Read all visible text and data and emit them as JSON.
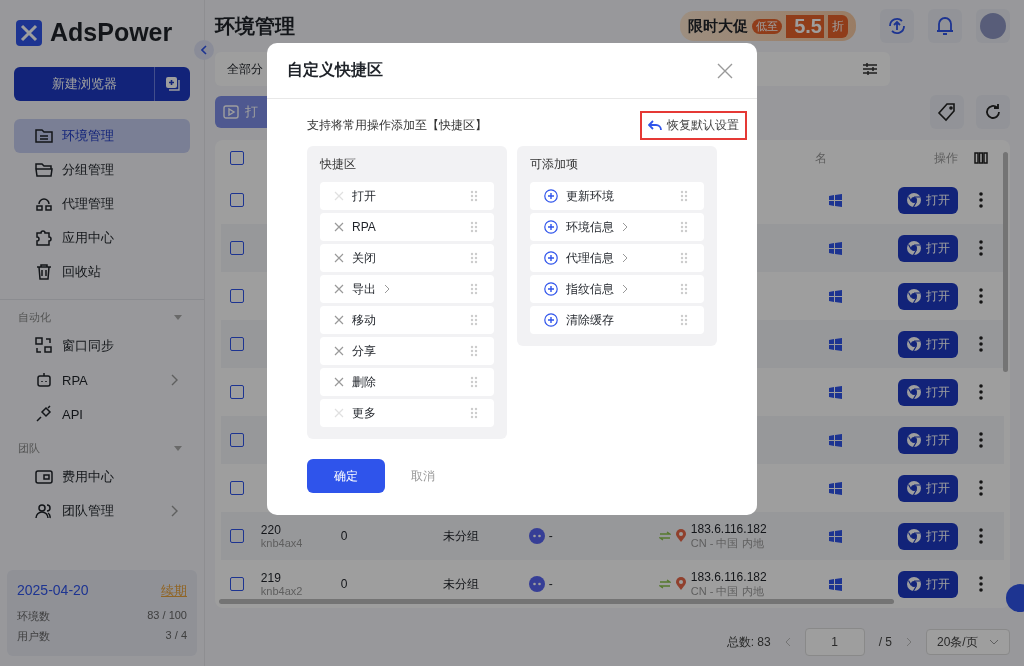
{
  "brand": {
    "name": "AdsPower"
  },
  "sidebar": {
    "new_button": "新建浏览器",
    "nav": [
      {
        "label": "环境管理",
        "kind": "folder-list",
        "selected": true
      },
      {
        "label": "分组管理",
        "kind": "folder",
        "selected": false
      },
      {
        "label": "代理管理",
        "kind": "network",
        "selected": false
      },
      {
        "label": "应用中心",
        "kind": "puzzle",
        "selected": false
      },
      {
        "label": "回收站",
        "kind": "trash",
        "selected": false
      }
    ],
    "sections": [
      {
        "title": "自动化",
        "items": [
          {
            "label": "窗口同步",
            "kind": "sync",
            "has_submenu": false
          },
          {
            "label": "RPA",
            "kind": "robot",
            "has_submenu": true
          },
          {
            "label": "API",
            "kind": "plug",
            "has_submenu": false
          }
        ]
      },
      {
        "title": "团队",
        "items": [
          {
            "label": "费用中心",
            "kind": "wallet",
            "has_submenu": false
          },
          {
            "label": "团队管理",
            "kind": "users",
            "has_submenu": true
          }
        ]
      }
    ],
    "plan": {
      "expiry": "2025-04-20",
      "renew": "续期",
      "stats": [
        {
          "label": "环境数",
          "value": "83 / 100"
        },
        {
          "label": "用户数",
          "value": "3 / 4"
        }
      ]
    }
  },
  "header": {
    "title": "环境管理",
    "promo": {
      "text": "限时大促",
      "tag": "低至",
      "discount": "5.5",
      "unit": "折"
    }
  },
  "toolbar": {
    "group_filter": "全部分",
    "open_button": "打"
  },
  "table": {
    "select_all_checked": false,
    "columns": [
      {
        "label": "名"
      },
      {
        "label": "操作"
      }
    ],
    "rows": [
      {
        "checked": false,
        "action": "打开"
      },
      {
        "checked": false,
        "action": "打开"
      },
      {
        "checked": false,
        "action": "打开"
      },
      {
        "checked": false,
        "action": "打开"
      },
      {
        "checked": false,
        "action": "打开"
      },
      {
        "checked": false,
        "action": "打开"
      },
      {
        "checked": false,
        "action": "打开"
      },
      {
        "checked": false,
        "id": "220",
        "code": "knb4ax4",
        "count": "0",
        "group": "未分组",
        "platform": "-",
        "ip": "183.6.116.182",
        "location": "CN - 中国 内地",
        "action": "打开"
      },
      {
        "checked": false,
        "id": "219",
        "code": "knb4ax2",
        "count": "0",
        "group": "未分组",
        "platform": "-",
        "ip": "183.6.116.182",
        "location": "CN - 中国 内地",
        "action": "打开"
      }
    ]
  },
  "pagination": {
    "total": "总数: 83",
    "page": "1",
    "pages": "/ 5",
    "page_size": "20条/页"
  },
  "dialog": {
    "title": "自定义快捷区",
    "hint": "支持将常用操作添加至【快捷区】",
    "restore": {
      "label": "恢复默认设置",
      "highlighted": true
    },
    "quick": {
      "title": "快捷区",
      "items": [
        {
          "label": "打开",
          "removable": false,
          "has_submenu": false
        },
        {
          "label": "RPA",
          "removable": true,
          "has_submenu": false
        },
        {
          "label": "关闭",
          "removable": true,
          "has_submenu": false
        },
        {
          "label": "导出",
          "removable": true,
          "has_submenu": true
        },
        {
          "label": "移动",
          "removable": true,
          "has_submenu": false
        },
        {
          "label": "分享",
          "removable": true,
          "has_submenu": false
        },
        {
          "label": "删除",
          "removable": true,
          "has_submenu": false
        },
        {
          "label": "更多",
          "removable": false,
          "has_submenu": false
        }
      ]
    },
    "available": {
      "title": "可添加项",
      "items": [
        {
          "label": "更新环境",
          "has_submenu": false
        },
        {
          "label": "环境信息",
          "has_submenu": true
        },
        {
          "label": "代理信息",
          "has_submenu": true
        },
        {
          "label": "指纹信息",
          "has_submenu": true
        },
        {
          "label": "清除缓存",
          "has_submenu": false
        }
      ]
    },
    "confirm": "确定",
    "cancel": "取消"
  }
}
